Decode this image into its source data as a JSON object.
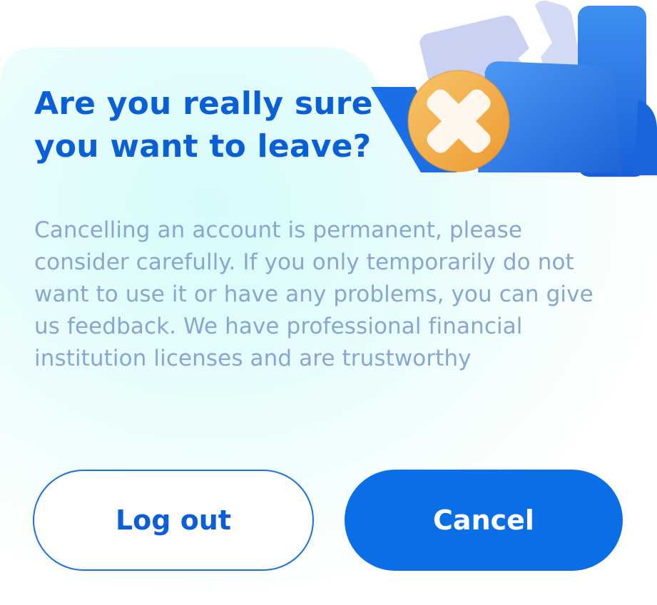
{
  "dialog": {
    "title": "Are you really sure you want to leave?",
    "message": "Cancelling an account is permanent, please consider carefully. If you only temporarily do not want to use it or have any problems, you can give us feedback. We have professional financial institution licenses and are trustworthy",
    "buttons": {
      "logout_label": "Log out",
      "cancel_label": "Cancel"
    },
    "illustration": {
      "icon": "folder-with-x-icon"
    }
  },
  "colors": {
    "accent": "#0a6fe6",
    "title": "#0b5fd6",
    "body_text": "#88a7cf",
    "badge": "#f2b14a"
  }
}
